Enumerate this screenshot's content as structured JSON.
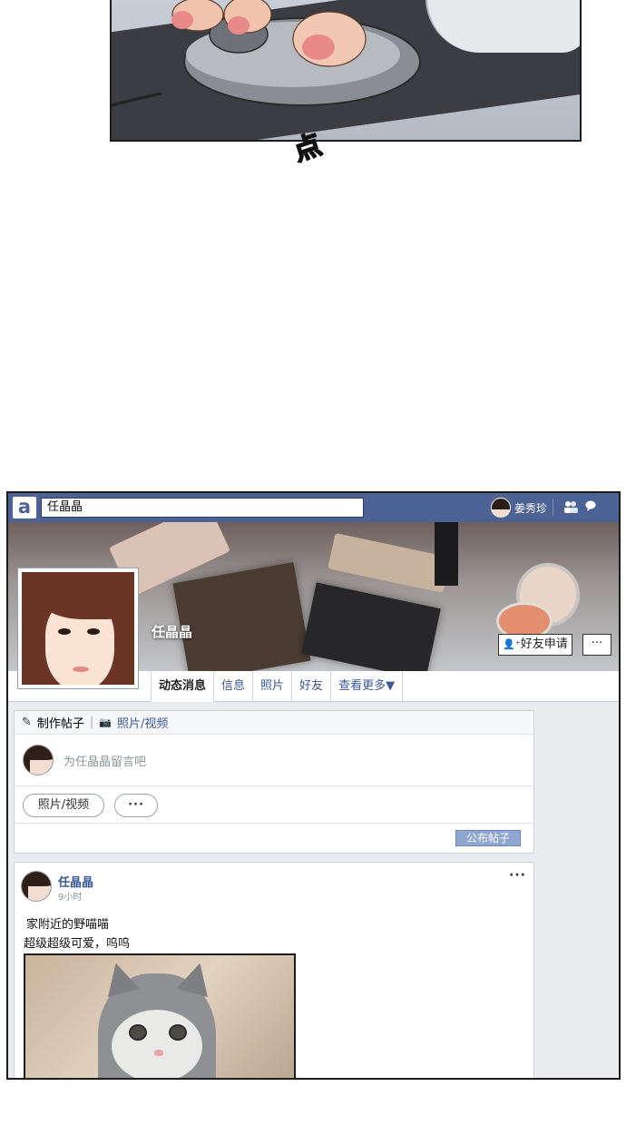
{
  "sfx": "点",
  "sns": {
    "logo_letter": "a",
    "search_value": "任晶晶",
    "current_user": "姜秀珍",
    "top_icons": [
      "friends-icon",
      "messages-icon"
    ],
    "profile": {
      "name": "任晶晶",
      "add_friend_label": "好友申请",
      "more_label": "···"
    },
    "tabs": [
      "动态消息",
      "信息",
      "照片",
      "好友",
      "查看更多▼"
    ],
    "composer": {
      "tab_post": "制作帖子",
      "tab_media": "照片/视频",
      "placeholder": "为任晶晶留言吧",
      "photo_video_button": "照片/视频",
      "more_button": "···",
      "publish_button": "公布帖子"
    },
    "post": {
      "author": "任晶晶",
      "time": "9小时",
      "menu": "···",
      "line1": "家附近的野喵喵",
      "line2": "超级超级可爱，呜呜"
    }
  },
  "colors": {
    "topbar": "#4c6294",
    "link": "#3b5998",
    "publish": "#8fa6d1"
  }
}
